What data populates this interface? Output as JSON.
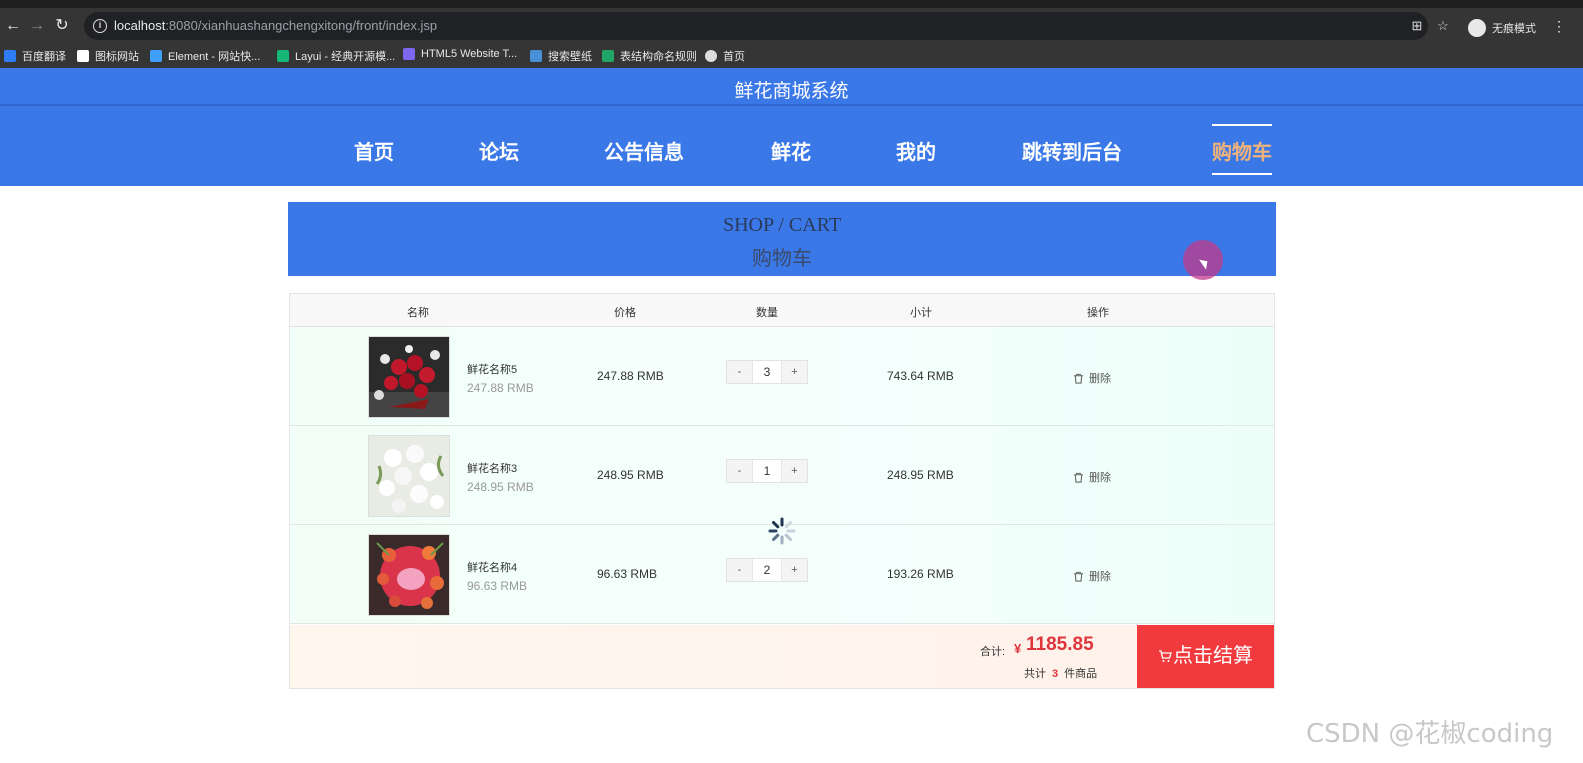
{
  "browser": {
    "url_host": "localhost",
    "url_rest": ":8080/xianhuashangchengxitong/front/index.jsp",
    "incognito_label": "无痕模式",
    "bookmarks": [
      {
        "label": "百度翻译",
        "color": "#2e7df6"
      },
      {
        "label": "图标网站",
        "color": "#ffffff"
      },
      {
        "label": "Element - 网站快...",
        "color": "#409eff"
      },
      {
        "label": "Layui - 经典开源模...",
        "color": "#16b777"
      },
      {
        "label": "HTML5 Website T...",
        "color": "#7b68ee"
      },
      {
        "label": "搜索壁纸",
        "color": "#4a90d9"
      },
      {
        "label": "表结构命名规则",
        "color": "#21a366"
      },
      {
        "label": "首页",
        "color": "#dddddd"
      }
    ]
  },
  "site": {
    "title": "鲜花商城系统",
    "nav": [
      "首页",
      "论坛",
      "公告信息",
      "鲜花",
      "我的",
      "跳转到后台",
      "购物车"
    ],
    "active_nav": "购物车",
    "primary_color": "#3b78e7",
    "active_nav_color": "#f0b27a"
  },
  "banner": {
    "en": "SHOP / CART",
    "cn": "购物车"
  },
  "cart": {
    "headers": {
      "name": "名称",
      "price": "价格",
      "qty": "数量",
      "subtotal": "小计",
      "action": "操作"
    },
    "items": [
      {
        "name": "鲜花名称5",
        "sub": "247.88 RMB",
        "price": "247.88 RMB",
        "qty": "3",
        "subtotal": "743.64 RMB",
        "delete": "删除"
      },
      {
        "name": "鲜花名称3",
        "sub": "248.95 RMB",
        "price": "248.95 RMB",
        "qty": "1",
        "subtotal": "248.95 RMB",
        "delete": "删除"
      },
      {
        "name": "鲜花名称4",
        "sub": "96.63 RMB",
        "price": "96.63 RMB",
        "qty": "2",
        "subtotal": "193.26 RMB",
        "delete": "删除"
      }
    ],
    "qty_minus": "-",
    "qty_plus": "+",
    "total_label": "合计:",
    "currency": "¥",
    "total": "1185.85",
    "count_prefix": "共计",
    "count": "3",
    "count_suffix": "件商品",
    "checkout_label": "点击结算"
  },
  "watermark": "CSDN @花椒coding"
}
